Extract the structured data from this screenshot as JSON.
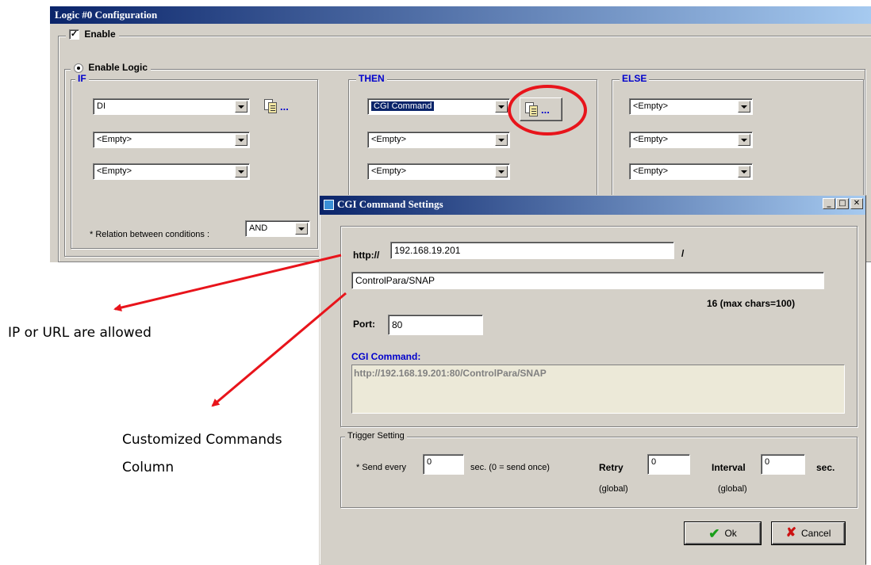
{
  "logic_window": {
    "title": "Logic #0 Configuration",
    "enable_label": "Enable",
    "enable_checked": true,
    "enable_logic_label": "Enable Logic",
    "if": {
      "label": "IF",
      "conditions": [
        "DI",
        "<Empty>",
        "<Empty>"
      ],
      "relation_label": "* Relation between conditions :",
      "relation_value": "AND"
    },
    "then": {
      "label": "THEN",
      "actions": [
        "CGI Command",
        "<Empty>",
        "<Empty>"
      ]
    },
    "else": {
      "label": "ELSE",
      "actions": [
        "<Empty>",
        "<Empty>",
        "<Empty>"
      ]
    },
    "settings_button_dots": "..."
  },
  "cgi_dialog": {
    "title": "CGI Command Settings",
    "http_label": "http://",
    "host_value": "192.168.19.201",
    "slash": "/",
    "path_value": "ControlPara/SNAP",
    "char_count": "16 (max chars=100)",
    "port_label": "Port:",
    "port_value": "80",
    "cgi_command_label": "CGI Command:",
    "cgi_command_value": "http://192.168.19.201:80/ControlPara/SNAP",
    "trigger": {
      "label": "Trigger Setting",
      "send_every_label": "* Send every",
      "send_every_value": "0",
      "send_every_unit": "sec. (0 = send once)",
      "retry_label": "Retry",
      "retry_value": "0",
      "retry_scope": "(global)",
      "interval_label": "Interval",
      "interval_value": "0",
      "interval_unit": "sec.",
      "interval_scope": "(global)"
    },
    "ok_label": "Ok",
    "cancel_label": "Cancel"
  },
  "annotations": {
    "ip_note": "IP or URL are allowed",
    "custom_note_line1": "Customized Commands",
    "custom_note_line2": "Column"
  },
  "colors": {
    "title_gradient_start": "#0a246a",
    "title_gradient_end": "#a6caf0",
    "annotation_arrow": "#e8141b",
    "highlight_circle": "#e8141b",
    "section_label": "#0000cc"
  }
}
